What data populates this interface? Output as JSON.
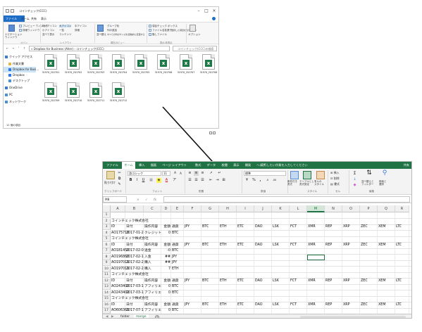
{
  "explorer": {
    "title": "コインチェック(CCC)",
    "tabs": [
      "ファイル",
      "ホーム",
      "共有",
      "表示"
    ],
    "window_buttons": [
      "–",
      "□",
      "×"
    ],
    "ribbon": {
      "pane_label": "ナビゲーション\nウィンドウ",
      "preview": "プレビュー ウィンドウ",
      "details": "詳細ウィンドウ",
      "icons_large": "特大アイコン",
      "icons_big": "大アイコン",
      "icons_mid": "中アイコン",
      "icons_small": "小アイコン",
      "list": "一覧",
      "detail": "詳細",
      "tiles": "並べて表示",
      "content": "コンテンツ",
      "sort": "並べ替え",
      "group": "グループ化",
      "add_col": "列の追加",
      "fit_col": "すべての列のサイズを自動的に変更する",
      "checkbox": "項目チェック ボックス",
      "ext": "ファイル名拡張子",
      "hidden": "隠しファイル",
      "hide_sel": "選択した項目を表示しない",
      "options": "オプション",
      "g_pane": "ペイン",
      "g_layout": "レイアウト",
      "g_view": "現在のビュー",
      "g_showhide": "表示/非表示"
    },
    "address": {
      "path": "« Dropbox for Business (Aher) › コインチェック(CCC)",
      "search": "コインチェック(CCC)の検索"
    },
    "nav_items": [
      {
        "label": "クイック アクセス",
        "color": "#3a7bd5"
      },
      {
        "label": "作業文書",
        "color": "#e0b84c"
      },
      {
        "label": "Dropbox for Busi...",
        "color": "#2e7be6"
      },
      {
        "label": "Dropbox",
        "color": "#2e7be6"
      },
      {
        "label": "デスクトップ",
        "color": "#4a90d9"
      },
      {
        "label": "OneDrive",
        "color": "#3a7bd5"
      },
      {
        "label": "PC",
        "color": "#4a90d9"
      },
      {
        "label": "ネットワーク",
        "color": "#4a90d9"
      }
    ],
    "files": [
      "31970_201701",
      "31970_201702",
      "31970_201703",
      "31970_201704",
      "31970_201705",
      "31970_201706",
      "31970_201707",
      "31970_201708",
      "31970_201709",
      "31970_201710",
      "31970_201711",
      "31970_201712"
    ],
    "status": "12 個の項目"
  },
  "excel": {
    "tabs": [
      "ファイル",
      "ホーム",
      "挿入",
      "描画",
      "ページ レイアウト",
      "数式",
      "データ",
      "校閲",
      "表示",
      "開発",
      "ヘルプ"
    ],
    "tell_me": "実行したい作業を入力してください",
    "share": "共有",
    "ribbon": {
      "paste": "貼り付け",
      "font_name": "游ゴシック",
      "font_size": "11",
      "number_format": "標準",
      "cond_format": "条件付き\n書式",
      "table_format": "テーブルとして\n書式設定",
      "cell_style": "セルの\nスタイル",
      "insert": "挿入",
      "delete": "削除",
      "format": "書式",
      "sort_filter": "並べ替えと\nフィルター",
      "find_select": "検索と\n選択",
      "g_clipboard": "クリップボード",
      "g_font": "フォント",
      "g_align": "配置",
      "g_number": "数値",
      "g_style": "スタイル",
      "g_cells": "セル",
      "g_edit": "編集"
    },
    "name_box": "M8",
    "fx": "fx",
    "columns": [
      "A",
      "B",
      "C",
      "D",
      "E",
      "F",
      "G",
      "H",
      "I",
      "J",
      "K",
      "L",
      "M",
      "N",
      "O",
      "P",
      "Q",
      "R"
    ],
    "selected_col": "M",
    "rows": [
      [
        "",
        "",
        "",
        "",
        "",
        "",
        "",
        "",
        "",
        "",
        "",
        "",
        "",
        "",
        "",
        "",
        "",
        ""
      ],
      [
        "コインチェック株式会社",
        "",
        "",
        "",
        "",
        "",
        "",
        "",
        "",
        "",
        "",
        "",
        "",
        "",
        "",
        "",
        "",
        ""
      ],
      [
        "ID",
        "日付",
        "操作内容",
        "金額",
        "通貨",
        "JPY",
        "BTC",
        "ETH",
        "ETC",
        "DAO",
        "LSK",
        "FCT",
        "XMR",
        "REP",
        "XRP",
        "ZEC",
        "XEM",
        "LTC"
      ],
      [
        "AO175716",
        "2017-01-2",
        "クレジット",
        "0",
        "BTC",
        "",
        "",
        "",
        "",
        "",
        "",
        "",
        "",
        "",
        "",
        "",
        "",
        ""
      ],
      [
        "コインチェック株式会社",
        "",
        "",
        "",
        "",
        "",
        "",
        "",
        "",
        "",
        "",
        "",
        "",
        "",
        "",
        "",
        "",
        ""
      ],
      [
        "ID",
        "日付",
        "操作内容",
        "金額",
        "通貨",
        "JPY",
        "BTC",
        "ETH",
        "ETC",
        "DAO",
        "LSK",
        "FCT",
        "XMR",
        "REP",
        "XRP",
        "ZEC",
        "XEM",
        "LTC"
      ],
      [
        "AO181450",
        "2017-02-0",
        "送金",
        "-0",
        "BTC",
        "",
        "",
        "",
        "",
        "",
        "",
        "",
        "",
        "",
        "",
        "",
        "",
        ""
      ],
      [
        "AO196860",
        "2017-02-1",
        "入金",
        "##",
        "JPY",
        "",
        "",
        "",
        "",
        "",
        "",
        "",
        "",
        "",
        "",
        "",
        "",
        ""
      ],
      [
        "AO197011",
        "2017-02-2",
        "購入",
        "##",
        "JPY",
        "",
        "",
        "",
        "",
        "",
        "",
        "",
        "",
        "",
        "",
        "",
        "",
        ""
      ],
      [
        "AO197011",
        "2017-02-2",
        "購入",
        "7",
        "ETH",
        "",
        "",
        "",
        "",
        "",
        "",
        "",
        "",
        "",
        "",
        "",
        "",
        ""
      ],
      [
        "コインチェック株式会社",
        "",
        "",
        "",
        "",
        "",
        "",
        "",
        "",
        "",
        "",
        "",
        "",
        "",
        "",
        "",
        "",
        ""
      ],
      [
        "ID",
        "日付",
        "操作内容",
        "金額",
        "通貨",
        "JPY",
        "BTC",
        "ETH",
        "ETC",
        "DAO",
        "LSK",
        "FCT",
        "XMR",
        "REP",
        "XRP",
        "ZEC",
        "XEM",
        "LTC"
      ],
      [
        "AO243400",
        "2017-03-1",
        "アフィリエ",
        "0",
        "BTC",
        "",
        "",
        "",
        "",
        "",
        "",
        "",
        "",
        "",
        "",
        "",
        "",
        ""
      ],
      [
        "AO243402",
        "2017-03-1",
        "アフィリエ",
        "0",
        "BTC",
        "",
        "",
        "",
        "",
        "",
        "",
        "",
        "",
        "",
        "",
        "",
        "",
        ""
      ],
      [
        "コインチェック株式会社",
        "",
        "",
        "",
        "",
        "",
        "",
        "",
        "",
        "",
        "",
        "",
        "",
        "",
        "",
        "",
        "",
        ""
      ],
      [
        "ID",
        "日付",
        "操作内容",
        "金額",
        "通貨",
        "JPY",
        "BTC",
        "ETH",
        "ETC",
        "DAO",
        "LSK",
        "FCT",
        "XMR",
        "REP",
        "XRP",
        "ZEC",
        "XEM",
        "LTC"
      ],
      [
        "AO606361",
        "2017-07-1",
        "アフィリエ",
        "0",
        "BTC",
        "",
        "",
        "",
        "",
        "",
        "",
        "",
        "",
        "",
        "",
        "",
        "",
        ""
      ]
    ],
    "sheets": [
      "folder",
      "merge"
    ],
    "active_sheet": "merge",
    "accent": "#217346"
  }
}
